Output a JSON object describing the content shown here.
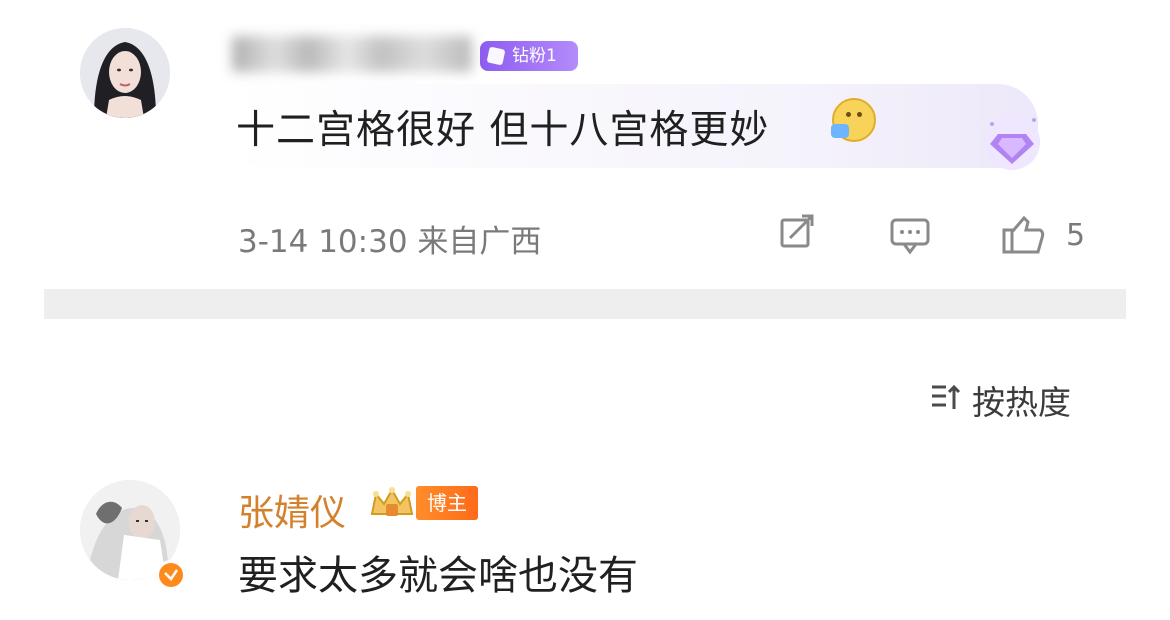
{
  "comment_top": {
    "user_badge": "钻粉1",
    "text": "十二宫格很好 但十八宫格更妙",
    "time_location": "3-14 10:30 来自广西",
    "like_count": "5",
    "icons": {
      "emoji": "tongue-out-emoji-icon",
      "deco": "diamond-gem-icon",
      "share": "forward-icon",
      "reply": "comment-icon",
      "like": "thumbs-up-icon"
    }
  },
  "sort": {
    "label": "按热度",
    "icon": "sort-icon"
  },
  "comment_bottom": {
    "username": "张婧仪",
    "role_badge": "博主",
    "text": "要求太多就会啥也没有",
    "icons": {
      "crown": "crown-badge-icon",
      "verify": "verified-icon"
    }
  },
  "colors": {
    "username_orange": "#d4812d",
    "fan_badge_purple": "#8d5cf0",
    "blogger_badge": "#ff6a1a",
    "meta_gray": "#7a7a7a",
    "divider_gray": "#eeeeee"
  }
}
